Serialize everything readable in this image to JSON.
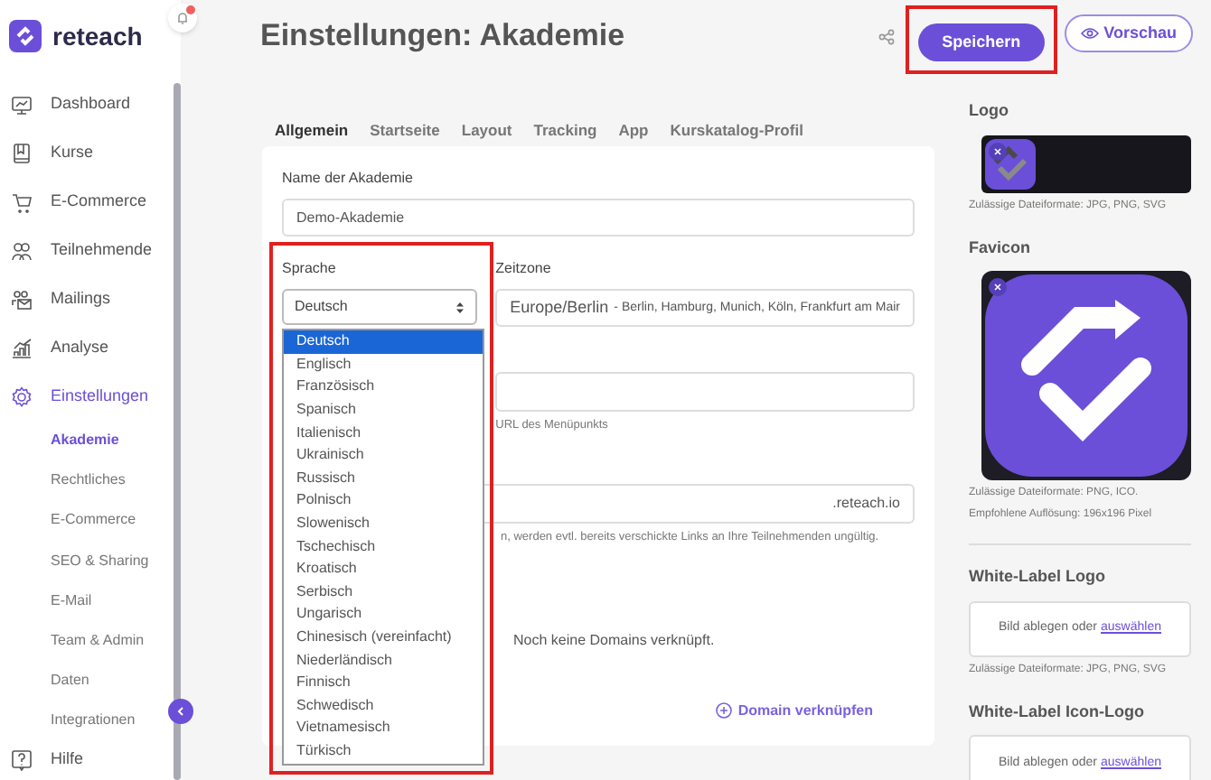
{
  "brand": "reteach",
  "notifications": {
    "unread": true
  },
  "sidebar": {
    "items": [
      {
        "label": "Dashboard",
        "selected": false
      },
      {
        "label": "Kurse",
        "selected": false
      },
      {
        "label": "E-Commerce",
        "selected": false
      },
      {
        "label": "Teilnehmende",
        "selected": false
      },
      {
        "label": "Mailings",
        "selected": false
      },
      {
        "label": "Analyse",
        "selected": false
      },
      {
        "label": "Einstellungen",
        "selected": true,
        "children": [
          {
            "label": "Akademie",
            "selected": true
          },
          {
            "label": "Rechtliches",
            "selected": false
          },
          {
            "label": "E-Commerce",
            "selected": false
          },
          {
            "label": "SEO & Sharing",
            "selected": false
          },
          {
            "label": "E-Mail",
            "selected": false
          },
          {
            "label": "Team & Admin",
            "selected": false
          },
          {
            "label": "Daten",
            "selected": false
          },
          {
            "label": "Integrationen",
            "selected": false
          }
        ]
      }
    ],
    "help": "Hilfe"
  },
  "page": {
    "title": "Einstellungen: Akademie",
    "save_button": {
      "label": "Speichern",
      "highlighted": true
    },
    "preview_button": "Vorschau"
  },
  "tabs": [
    {
      "label": "Allgemein",
      "selected": true
    },
    {
      "label": "Startseite",
      "selected": false
    },
    {
      "label": "Layout",
      "selected": false
    },
    {
      "label": "Tracking",
      "selected": false
    },
    {
      "label": "App",
      "selected": false
    },
    {
      "label": "Kurskatalog-Profil",
      "selected": false
    }
  ],
  "form": {
    "name": {
      "label": "Name der Akademie",
      "value": "Demo-Akademie"
    },
    "language": {
      "label": "Sprache",
      "value": "Deutsch",
      "highlighted": true,
      "expanded": true,
      "options": [
        {
          "label": "Deutsch",
          "selected": true
        },
        {
          "label": "Englisch",
          "selected": false
        },
        {
          "label": "Französisch",
          "selected": false
        },
        {
          "label": "Spanisch",
          "selected": false
        },
        {
          "label": "Italienisch",
          "selected": false
        },
        {
          "label": "Ukrainisch",
          "selected": false
        },
        {
          "label": "Russisch",
          "selected": false
        },
        {
          "label": "Polnisch",
          "selected": false
        },
        {
          "label": "Slowenisch",
          "selected": false
        },
        {
          "label": "Tschechisch",
          "selected": false
        },
        {
          "label": "Kroatisch",
          "selected": false
        },
        {
          "label": "Serbisch",
          "selected": false
        },
        {
          "label": "Ungarisch",
          "selected": false
        },
        {
          "label": "Chinesisch (vereinfacht)",
          "selected": false
        },
        {
          "label": "Niederländisch",
          "selected": false
        },
        {
          "label": "Finnisch",
          "selected": false
        },
        {
          "label": "Schwedisch",
          "selected": false
        },
        {
          "label": "Vietnamesisch",
          "selected": false
        },
        {
          "label": "Türkisch",
          "selected": false
        }
      ]
    },
    "timezone": {
      "label": "Zeitzone",
      "value": "Europe/Berlin",
      "detail": "- Berlin, Hamburg, Munich, Köln, Frankfurt am Mair"
    },
    "menu_url": {
      "hint": "URL des Menüpunkts"
    },
    "subdomain": {
      "suffix": ".reteach.io",
      "hint": "n, werden evtl. bereits verschickte Links an Ihre Teilnehmenden ungültig."
    },
    "domains": {
      "empty_text": "Noch keine Domains verknüpft.",
      "add_button": "Domain verknüpfen"
    }
  },
  "assets": [
    {
      "kind": "logo",
      "title": "Logo",
      "hints": [
        "Zulässige Dateiformate: JPG, PNG, SVG"
      ]
    },
    {
      "kind": "favicon",
      "title": "Favicon",
      "hints": [
        "Zulässige Dateiformate: PNG, ICO.",
        "Empfohlene Auflösung: 196x196 Pixel"
      ]
    },
    {
      "kind": "dropzone",
      "title": "White-Label Logo",
      "drop_text": "Bild ablegen oder",
      "link": "auswählen",
      "hints": [
        "Zulässige Dateiformate: JPG, PNG, SVG"
      ]
    },
    {
      "kind": "dropzone",
      "title": "White-Label Icon-Logo",
      "drop_text": "Bild ablegen oder",
      "link": "auswählen"
    }
  ]
}
